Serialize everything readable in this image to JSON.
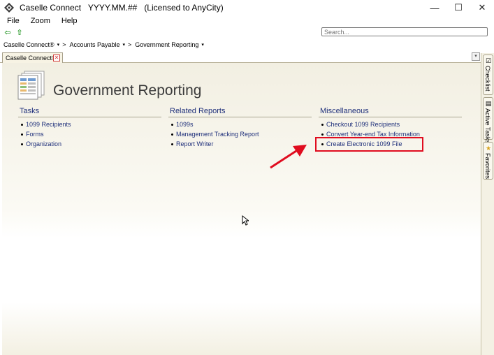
{
  "window": {
    "title": "Caselle Connect   YYYY.MM.##   (Licensed to AnyCity)",
    "controls": {
      "minimize": "—",
      "maximize": "☐",
      "close": "✕"
    }
  },
  "menu": {
    "items": [
      "File",
      "Zoom",
      "Help"
    ]
  },
  "toolbar": {
    "back_icon": "⇦",
    "up_icon": "⇧"
  },
  "search": {
    "placeholder": "Search..."
  },
  "breadcrumb": {
    "items": [
      "Caselle Connect®",
      "Accounts Payable",
      "Government Reporting"
    ],
    "separator": ">",
    "dropdown": "▾"
  },
  "tab": {
    "label": "Caselle Connect®",
    "close": "✕",
    "menu_glyph": "▾"
  },
  "page": {
    "title": "Government Reporting"
  },
  "sections": {
    "tasks": {
      "title": "Tasks",
      "links": [
        "1099 Recipients",
        "Forms",
        "Organization"
      ]
    },
    "related_reports": {
      "title": "Related Reports",
      "links": [
        "1099s",
        "Management Tracking Report",
        "Report Writer"
      ]
    },
    "miscellaneous": {
      "title": "Miscellaneous",
      "links": [
        "Checkout 1099 Recipients",
        "Convert Year-end Tax Information",
        "Create Electronic 1099 File"
      ]
    }
  },
  "side_tabs": {
    "checklist": "Checklist",
    "active_tasks": "Active Tasks",
    "favorites": "Favorites"
  },
  "colors": {
    "link": "#1e2f7a",
    "highlight": "#e00c1f",
    "content_bg": "#f2efe2"
  }
}
